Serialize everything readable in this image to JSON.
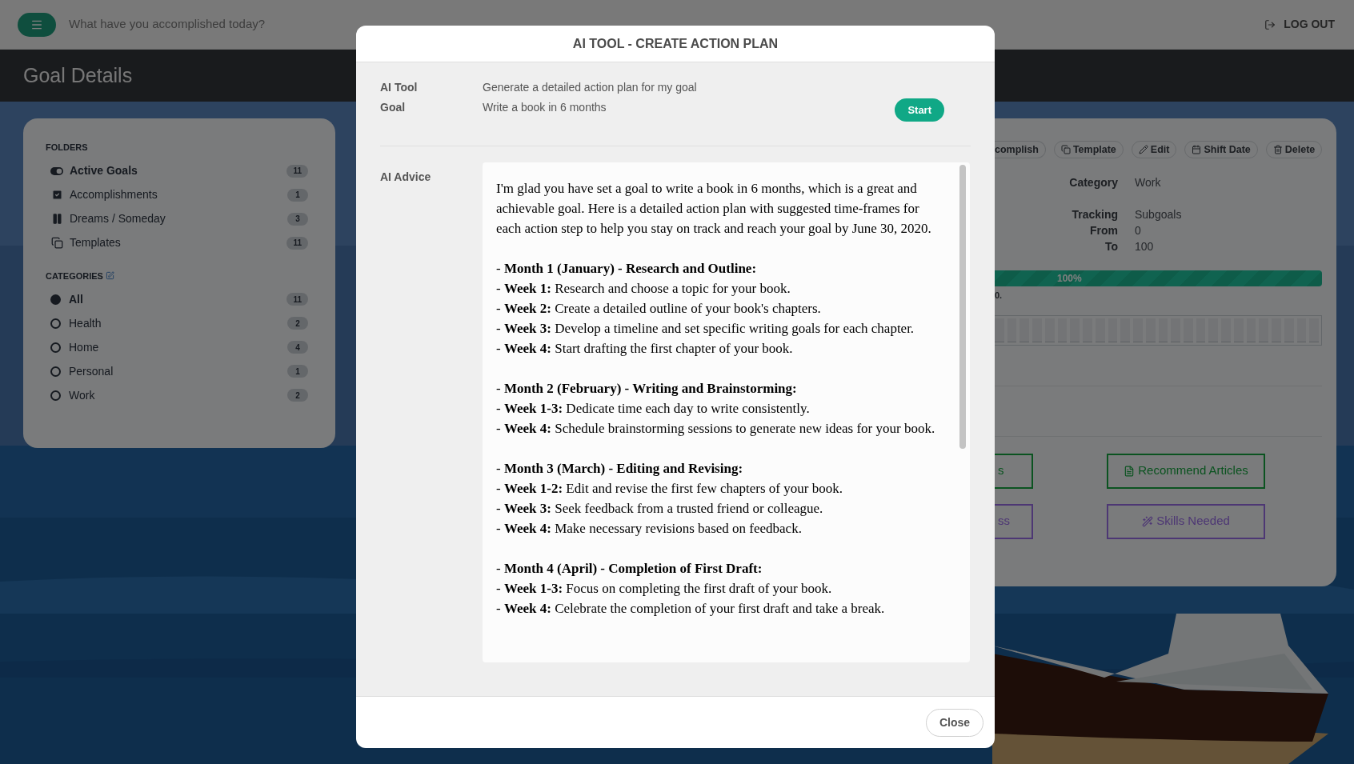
{
  "topbar": {
    "placeholder": "What have you accomplished today?",
    "logout": "LOG OUT"
  },
  "header": {
    "title": "Goal Details"
  },
  "sidebar": {
    "folders_title": "FOLDERS",
    "folders": [
      {
        "label": "Active Goals",
        "count": "11",
        "kind": "toggle",
        "selected": true
      },
      {
        "label": "Accomplishments",
        "count": "1",
        "kind": "check",
        "selected": false
      },
      {
        "label": "Dreams / Someday",
        "count": "3",
        "kind": "pause",
        "selected": false
      },
      {
        "label": "Templates",
        "count": "11",
        "kind": "copy",
        "selected": false
      }
    ],
    "categories_title": "CATEGORIES",
    "categories": [
      {
        "label": "All",
        "count": "11",
        "selected": true
      },
      {
        "label": "Health",
        "count": "2",
        "selected": false
      },
      {
        "label": "Home",
        "count": "4",
        "selected": false
      },
      {
        "label": "Personal",
        "count": "1",
        "selected": false
      },
      {
        "label": "Work",
        "count": "2",
        "selected": false
      }
    ]
  },
  "goal_panel": {
    "actions": [
      {
        "label": "complish",
        "kind": "plain"
      },
      {
        "label": "Template",
        "kind": "copy"
      },
      {
        "label": "Edit",
        "kind": "pencil"
      },
      {
        "label": "Shift Date",
        "kind": "calendar"
      },
      {
        "label": "Delete",
        "kind": "trash"
      }
    ],
    "details": [
      {
        "label": "Category",
        "value": "Work"
      },
      {
        "label": "Tracking",
        "value": "Subgoals"
      },
      {
        "label": "From",
        "value": "0"
      },
      {
        "label": "To",
        "value": "100"
      }
    ],
    "progress": {
      "level": 1,
      "reading": "100%"
    },
    "note": "0.",
    "buttons": [
      {
        "label": "s",
        "kind": "partial"
      },
      {
        "label": "Recommend Articles",
        "kind": "file"
      },
      {
        "label": "ss",
        "kind": "partial"
      },
      {
        "label": "Skills Needed",
        "kind": "wand"
      }
    ]
  },
  "modal": {
    "title": "AI TOOL - CREATE ACTION PLAN",
    "fields": [
      {
        "label": "AI Tool",
        "value": "Generate a detailed action plan for my goal"
      },
      {
        "label": "Goal",
        "value": "Write a book in 6 months"
      }
    ],
    "start": "Start",
    "advice_label": "AI Advice",
    "advice": [
      {
        "lines": [
          "I'm glad you have set a goal to write a book in 6 months, which is a great and achievable goal. Here is a detailed action plan with suggested time-frames for each action step to help you stay on track and reach your goal by June 30, 2020."
        ]
      },
      {
        "lines": [
          "- **Month 1 (January) - Research and Outline:**",
          "- **Week 1:** Research and choose a topic for your book.",
          "- **Week 2:** Create a detailed outline of your book's chapters.",
          "- **Week 3:** Develop a timeline and set specific writing goals for each chapter.",
          "- **Week 4:** Start drafting the first chapter of your book."
        ]
      },
      {
        "lines": [
          "- **Month 2 (February) - Writing and Brainstorming:**",
          "- **Week 1-3:** Dedicate time each day to write consistently.",
          "- **Week 4:** Schedule brainstorming sessions to generate new ideas for your book."
        ]
      },
      {
        "lines": [
          "- **Month 3 (March) - Editing and Revising:**",
          "- **Week 1-2:** Edit and revise the first few chapters of your book.",
          "- **Week 3:** Seek feedback from a trusted friend or colleague.",
          "- **Week 4:** Make necessary revisions based on feedback."
        ]
      },
      {
        "lines": [
          "- **Month 4 (April) - Completion of First Draft:**",
          "- **Week 1-3:** Focus on completing the first draft of your book.",
          "- **Week 4:** Celebrate the completion of your first draft and take a break."
        ]
      }
    ],
    "close": "Close"
  }
}
